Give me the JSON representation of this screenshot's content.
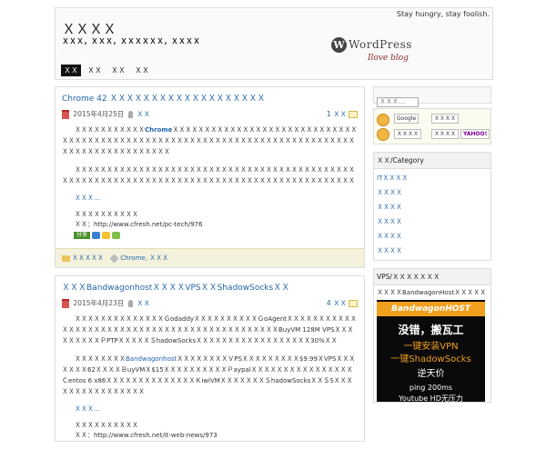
{
  "header": {
    "site_title": "ＸＸＸＸ",
    "site_desc": "ＸＸＸ，ＸＸＸ，ＸＸＸＸＸＸ，ＸＸＸＸ",
    "slogan": "Stay hungry, stay foolish.",
    "logo_text": "WordPress",
    "logo_sub": "Ilove blog",
    "nav": [
      "ＸＸ",
      "ＸＸ",
      "ＸＸ",
      "ＸＸ"
    ]
  },
  "posts": [
    {
      "title": "Chrome 42 ＸＸＸＸＸＸＸＸＸＸＸＸＸＸＸＸＸＸＸ",
      "date": "2015年4月25日",
      "author": "ＸＸ",
      "comments": "1 ＸＸ",
      "para1_pre": "ＸＸＸＸＸＸＸＸＸＸＸ",
      "para1_hl": "Chrome",
      "para1_post": "ＸＸＸＸＸＸＸＸＸＸＸＸＸＸＸＸＸＸＸＸＸＸＸＸＸＸＸＸＸＸＸＸＸＸＸＸＸＸＸＸＸＸＸＸＸＸＸＸＸＸＸＸＸＸＸＸＸＸＸＸＸＸＸＸＸＸＸＸＸＸＸＸＸＸＸＸＸＸＸＸＸＸＸＸＸＸＸＸＸＸＸＸ",
      "para2": "ＸＸＸＸＸＸＸＸＸＸＸＸＸＸＸＸＸＸＸＸＸＸＸＸＸＸＸＸＸＸＸＸＸＸＸＸＸＸＸＸＸＸＸＸＸＸＸＸＸＸＸＸＸＸＸＸＸＸＸＸＸＸＸＸＸＸＸＸＸＸＸＸＸＸＸＸＸＸＸＸＸＸＸＸＸＸＸＸＸＸ",
      "more": "ＸＸＸ…",
      "src_label": "ＸＸＸＸＸＸＸＸＸＸ",
      "src_url": "ＸＸ：http://www.cfresh.net/pc-tech/976",
      "share_label": "分享",
      "category": "ＸＸＸＸＸ",
      "tags": "Chrome, ＸＸＸ"
    },
    {
      "title": "ＸＸＸBandwagonhostＸＸＸＸVPSＸＸShadowSocksＸＸ",
      "date": "2015年4月23日",
      "author": "ＸＸ",
      "comments": "4 ＸＸ",
      "para1_pre": "ＸＸＸＸＸＸＸＸＸＸＸＸＸＸＧodaddyＸＸＸＸＸＸＸＸＸＸＧoAgentＸＸＸＸＸＸＸＸＸＸＸＸＸＸＸＸＸＸＸＸＸＸＸＸＸＸＸＸＸＸＸＸＸＸＸＸＸＸＸＸＸＸＸＸＸBuyVM 128M VPSＸＸＸＸＸＸＸＸＸＰPTPＸＸＸＸＸＳhadowSocksＸＸＸＸＸＸＸＸＸＸＸＸＸＸＸＸＸＸ30%ＸＸ",
      "para2_pre": "ＸＸＸＸＸＸＸＸ",
      "para2_hl": "Bandwagonhost",
      "para2_post": "ＸＸＸＸＸＸＸＸＶPSＸＸＸＸＸＸＸＸＸ$9.99ＸVPSＸＸＸＸＸＸＸ62ＸＸＸＸＢuyVMＸ$15ＸＸＸＸＸＸＸＸＸＸＰaypalＸＸＸＸＸＸＸＸＸＸＸＸＸＸＸＸＣentos 6 x86ＸＸＸＸＸＸＸＸＸＸＸＸＸＸＫiwiVMＸＸＸＸＸＸＸＳhadowSocksＸＸＳSＸＸＸＸＸＸＸＸＸＸＸＸＸＸＸＸ",
      "more": "ＸＸＸ…",
      "src_label": "ＸＸＸＸＸＸＸＸＸＸ",
      "src_url": "ＸＸ：http://www.cfresh.net/it-web-news/973"
    }
  ],
  "sidebar": {
    "search_placeholder": "ＸＸＸ…",
    "feeds": [
      "Google",
      "ＸＸＸＸ",
      "ＸＸＸＸ",
      "ＸＸＸＸ",
      "YAHOO!"
    ],
    "category_title": "ＸＸ/Category",
    "categories": [
      "ITＸＸＸＸ",
      "ＸＸＸＸ",
      "ＸＸＸＸ",
      "ＸＸＸＸ",
      "ＸＸＸＸ",
      "ＸＸＸＸ"
    ],
    "vps_title": "VPS/ＸＸＸＸＸＸＸ",
    "vps_intro": "ＸＸＸＸBandwagonHostＸＸＸＸＸ",
    "banner_brand": "BandwagonHOST",
    "banner_line1": "没错，搬瓦工",
    "banner_line2": "一键安装VPN",
    "banner_line3": "一键ShadowSocks",
    "banner_line4": "逆天价",
    "banner_line5": "ping 200ms",
    "banner_line6": "Youtube HD无压力"
  }
}
